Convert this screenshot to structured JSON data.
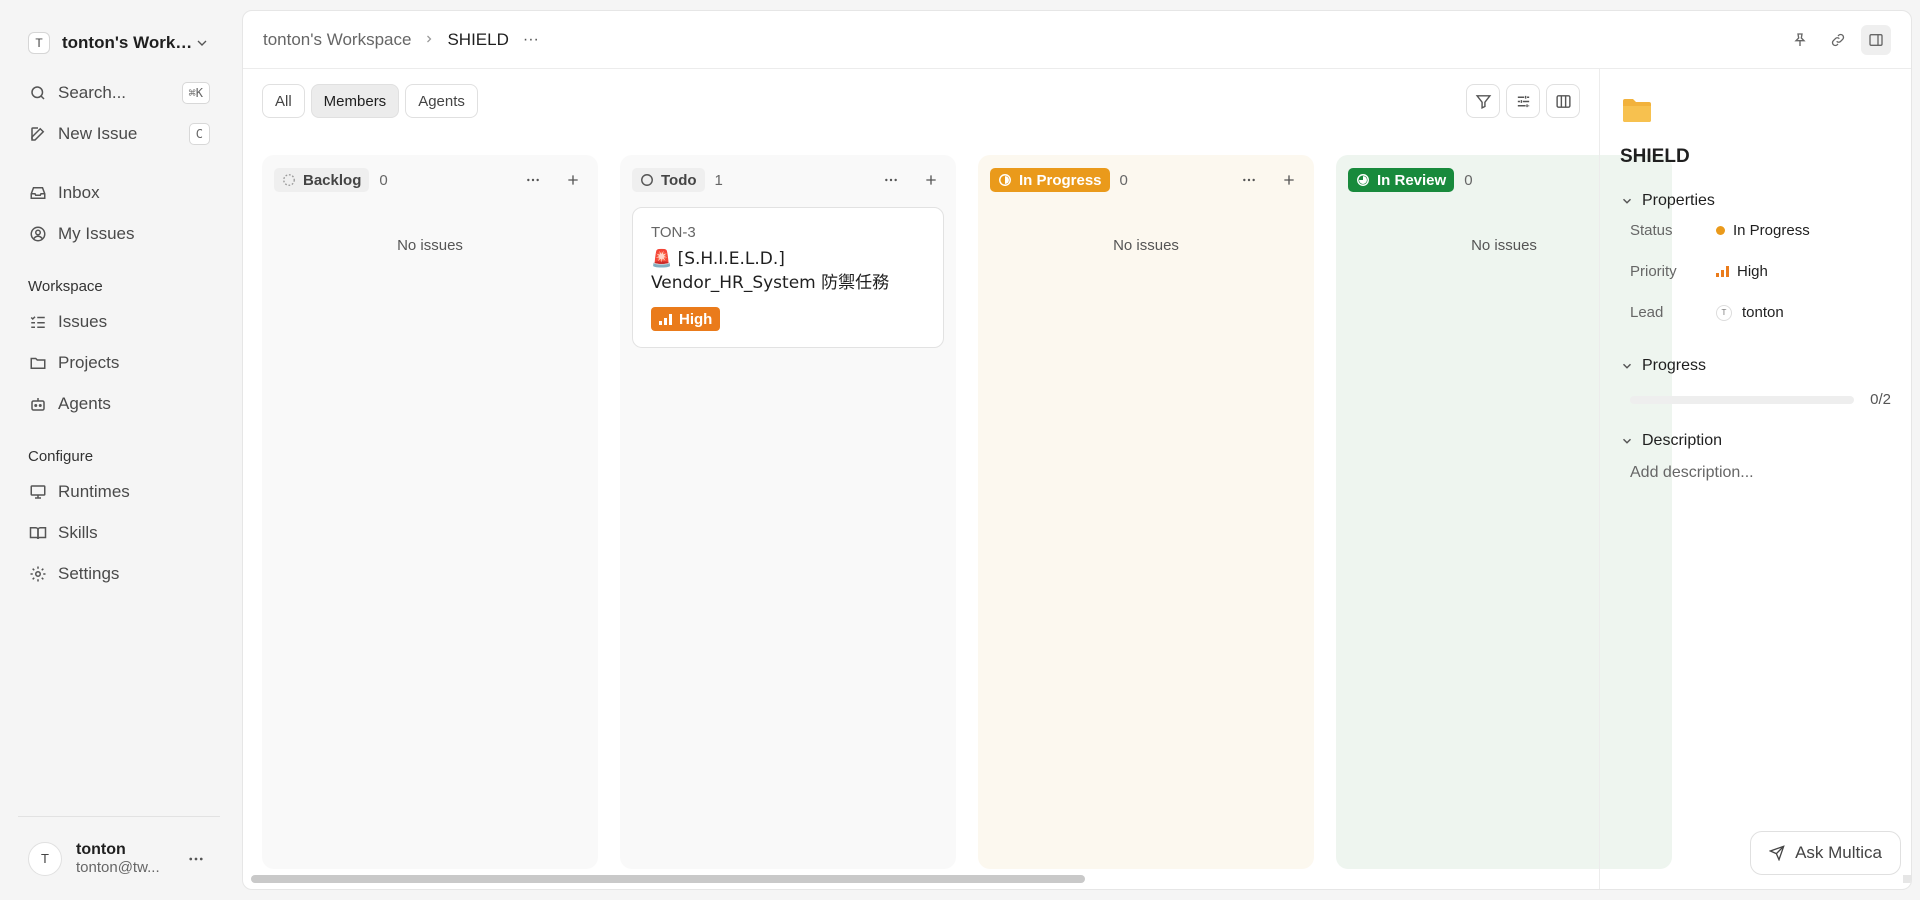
{
  "sidebar": {
    "workspace_avatar": "T",
    "workspace_name": "tonton's Workspace",
    "search_label": "Search...",
    "search_shortcut": "⌘K",
    "new_issue_label": "New Issue",
    "new_issue_shortcut": "C",
    "inbox_label": "Inbox",
    "my_issues_label": "My Issues",
    "workspace_section": "Workspace",
    "issues_label": "Issues",
    "projects_label": "Projects",
    "agents_label": "Agents",
    "configure_section": "Configure",
    "runtimes_label": "Runtimes",
    "skills_label": "Skills",
    "settings_label": "Settings",
    "user": {
      "avatar": "T",
      "name": "tonton",
      "email": "tonton@tw..."
    }
  },
  "breadcrumb": {
    "workspace": "tonton's Workspace",
    "current": "SHIELD",
    "more": "···"
  },
  "filters": {
    "all": "All",
    "members": "Members",
    "agents": "Agents",
    "active": "Members"
  },
  "columns": {
    "backlog": {
      "label": "Backlog",
      "count": "0",
      "empty_text": "No issues"
    },
    "todo": {
      "label": "Todo",
      "count": "1"
    },
    "in_progress": {
      "label": "In Progress",
      "count": "0",
      "empty_text": "No issues"
    },
    "in_review": {
      "label": "In Review",
      "count": "0",
      "empty_text": "No issues"
    }
  },
  "card": {
    "id": "TON-3",
    "emoji": "🚨",
    "title_line1": "[S.H.I.E.L.D.]",
    "title_line2": "Vendor_HR_System 防禦任務",
    "priority": "High"
  },
  "detail": {
    "title": "SHIELD",
    "properties_heading": "Properties",
    "status_label": "Status",
    "status_value": "In Progress",
    "priority_label": "Priority",
    "priority_value": "High",
    "lead_label": "Lead",
    "lead_avatar": "T",
    "lead_value": "tonton",
    "progress_heading": "Progress",
    "progress_text": "0/2",
    "progress_fraction": 0,
    "description_heading": "Description",
    "description_placeholder": "Add description...",
    "ask_label": "Ask Multica"
  },
  "colors": {
    "in_progress": "#ea9a1b",
    "in_review": "#188a3c",
    "priority_high": "#ea7b1b"
  }
}
